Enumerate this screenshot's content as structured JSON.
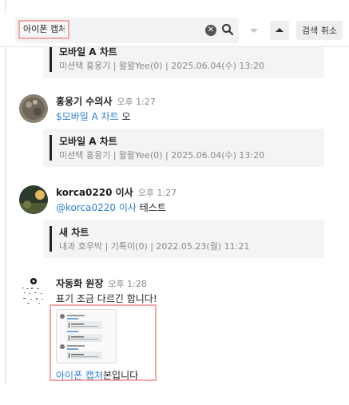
{
  "search": {
    "query": "아이폰 캡처",
    "cancel_label": "검색 취소"
  },
  "messages": [
    {
      "quote_title": "모바일 A 차트",
      "quote_meta": "미션택 홍웅기 | 왈왈Yee(0) | 2025.06.04(수) 13:20"
    },
    {
      "sender": "홍웅기 수의사",
      "time": "오후 1:27",
      "mention": "$모바일 A 차트",
      "text": " 오",
      "quote_title": "모바일 A 차트",
      "quote_meta": "미션택 홍웅기 | 왈왈Yee(0) | 2025.06.04(수) 13:20"
    },
    {
      "sender": "korca0220 이사",
      "time": "오후 1:27",
      "mention": "@korca0220 이사",
      "text": " 테스트",
      "quote_title": "새 차트",
      "quote_meta": "내과 호우박 | 기특이(0) | 2022.05.23(월) 11:21"
    },
    {
      "sender": "자동화 원장",
      "time": "오후 1:28",
      "text": "표기 조금 다르긴 합니다!",
      "caption_highlight": "아이폰 캡처",
      "caption_rest": "본입니다"
    }
  ],
  "colors": {
    "mention": "#2f80d1",
    "highlight_border": "#f2a7a7",
    "quote_bg": "#f3f4f6"
  },
  "icons": [
    "clear-icon",
    "search-icon",
    "arrow-down-icon",
    "arrow-up-icon"
  ]
}
